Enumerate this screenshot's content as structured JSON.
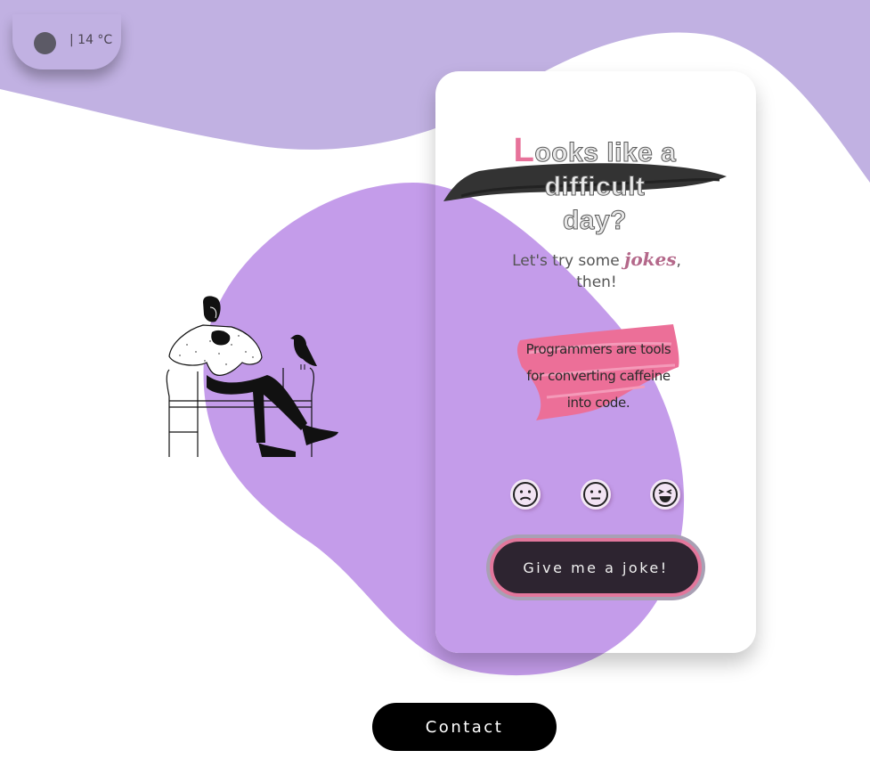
{
  "weather": {
    "temperature": "| 14 °C",
    "icon": "moon-icon"
  },
  "card": {
    "headline_first_letter": "L",
    "headline_line1_rest": "ooks like a",
    "headline_line2": "difficult",
    "headline_line3": "day?",
    "subline_before": "Let's try some ",
    "subline_emphasis": "jokes",
    "subline_after": ",",
    "subline_line2": "then!",
    "joke_line1": "Programmers are tools",
    "joke_line2": "for converting caffeine",
    "joke_line3": "into code.",
    "reactions": [
      "sad-face-icon",
      "neutral-face-icon",
      "laughing-face-icon"
    ],
    "button_label": "Give me a joke!"
  },
  "footer": {
    "contact_label": "Contact"
  },
  "colors": {
    "lavender": "#c1b1e2",
    "purple_blob": "#c49cea",
    "pink_accent": "#e7729a",
    "dark_button": "#2d2430"
  }
}
